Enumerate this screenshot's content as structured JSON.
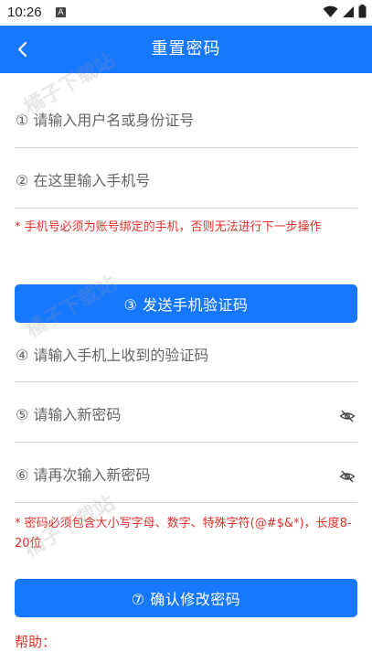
{
  "status_bar": {
    "time": "10:26",
    "notification_badge": "A"
  },
  "app_bar": {
    "title": "重置密码"
  },
  "form": {
    "username_placeholder": "① 请输入用户名或身份证号",
    "phone_placeholder": "② 在这里输入手机号",
    "phone_note": "* 手机号必须为账号绑定的手机，否则无法进行下一步操作",
    "send_code_label": "③ 发送手机验证码",
    "code_placeholder": "④ 请输入手机上收到的验证码",
    "new_password_placeholder": "⑤ 请输入新密码",
    "confirm_password_placeholder": "⑥ 请再次输入新密码",
    "password_note": "* 密码必须包含大小写字母、数字、特殊字符(@#$&*)，长度8-20位",
    "confirm_label": "⑦ 确认修改密码",
    "help_label": "帮助："
  },
  "watermark": {
    "text": "橘子下载站"
  },
  "colors": {
    "primary": "#1677ff",
    "warning": "#e0312a"
  }
}
